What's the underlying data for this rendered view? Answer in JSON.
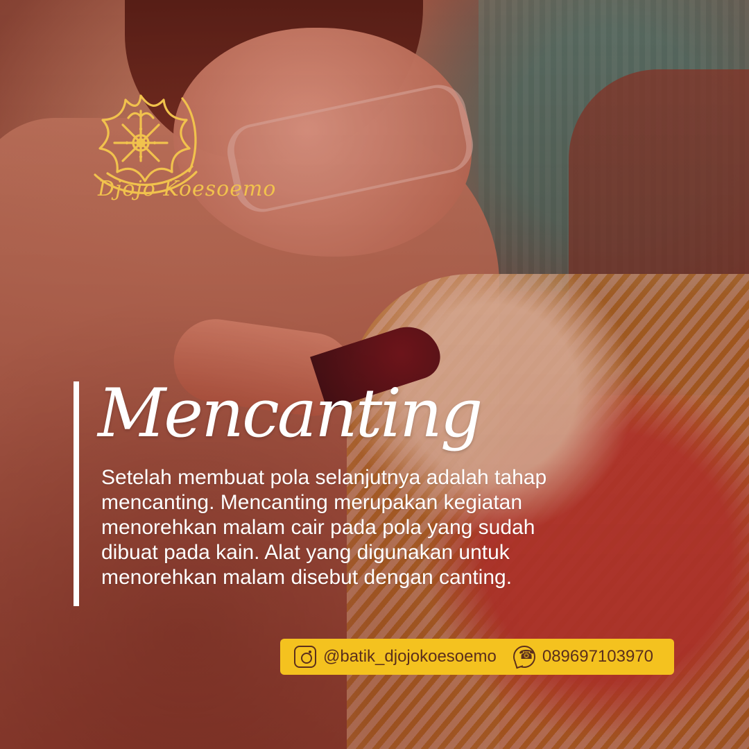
{
  "brand": {
    "logo_text": "Djojo Koesoemo"
  },
  "post": {
    "title": "Mencanting",
    "body": "Setelah membuat pola selanjutnya adalah tahap\nmencanting. Mencanting merupakan kegiatan\nmenorehkan malam cair pada pola yang sudah\ndibuat pada kain. Alat yang digunakan untuk\nmenorehkan malam disebut dengan canting."
  },
  "contact": {
    "instagram_icon": "instagram-icon",
    "instagram_handle": "@batik_djojokoesoemo",
    "whatsapp_icon": "whatsapp-icon",
    "phone": "089697103970"
  },
  "colors": {
    "gold": "#f1c24d",
    "contact_bar": "#f4c21f",
    "contact_text": "#5b2f1c",
    "white": "#ffffff"
  }
}
